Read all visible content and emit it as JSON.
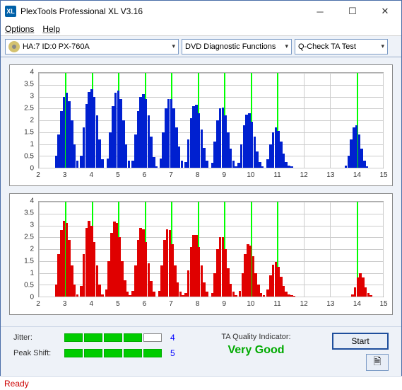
{
  "window": {
    "title": "PlexTools Professional XL V3.16"
  },
  "menu": {
    "options": "Options",
    "help": "Help"
  },
  "toolbar": {
    "device": "HA:7 ID:0   PX-760A",
    "diag": "DVD Diagnostic Functions",
    "test": "Q-Check TA Test"
  },
  "chart_data": [
    {
      "type": "bar",
      "color": "#0020d0",
      "xlim": [
        2,
        15
      ],
      "ylim": [
        0,
        4
      ],
      "yticks": [
        0,
        0.5,
        1,
        1.5,
        2,
        2.5,
        3,
        3.5,
        4
      ],
      "xticks": [
        2,
        3,
        4,
        5,
        6,
        7,
        8,
        9,
        10,
        11,
        12,
        13,
        14,
        15
      ],
      "markers": [
        3,
        4,
        5,
        6,
        7,
        8,
        9,
        10,
        11,
        14
      ],
      "series": [
        {
          "x": 2.65,
          "y": 0.5
        },
        {
          "x": 2.75,
          "y": 1.4
        },
        {
          "x": 2.85,
          "y": 2.4
        },
        {
          "x": 2.95,
          "y": 3.0
        },
        {
          "x": 3.05,
          "y": 3.15
        },
        {
          "x": 3.15,
          "y": 2.8
        },
        {
          "x": 3.25,
          "y": 2.0
        },
        {
          "x": 3.35,
          "y": 1.0
        },
        {
          "x": 3.45,
          "y": 0.3
        },
        {
          "x": 3.6,
          "y": 0.5
        },
        {
          "x": 3.7,
          "y": 1.7
        },
        {
          "x": 3.8,
          "y": 2.7
        },
        {
          "x": 3.9,
          "y": 3.2
        },
        {
          "x": 4.0,
          "y": 3.3
        },
        {
          "x": 4.1,
          "y": 3.0
        },
        {
          "x": 4.2,
          "y": 2.2
        },
        {
          "x": 4.3,
          "y": 1.2
        },
        {
          "x": 4.4,
          "y": 0.35
        },
        {
          "x": 4.6,
          "y": 0.4
        },
        {
          "x": 4.7,
          "y": 1.5
        },
        {
          "x": 4.8,
          "y": 2.6
        },
        {
          "x": 4.9,
          "y": 3.15
        },
        {
          "x": 5.0,
          "y": 3.25
        },
        {
          "x": 5.1,
          "y": 2.9
        },
        {
          "x": 5.2,
          "y": 2.0
        },
        {
          "x": 5.3,
          "y": 1.0
        },
        {
          "x": 5.4,
          "y": 0.3
        },
        {
          "x": 5.55,
          "y": 0.3
        },
        {
          "x": 5.65,
          "y": 1.4
        },
        {
          "x": 5.75,
          "y": 2.4
        },
        {
          "x": 5.85,
          "y": 3.0
        },
        {
          "x": 5.95,
          "y": 3.1
        },
        {
          "x": 6.05,
          "y": 2.9
        },
        {
          "x": 6.15,
          "y": 2.2
        },
        {
          "x": 6.25,
          "y": 1.3
        },
        {
          "x": 6.35,
          "y": 0.45
        },
        {
          "x": 6.45,
          "y": 0.05
        },
        {
          "x": 6.6,
          "y": 0.4
        },
        {
          "x": 6.7,
          "y": 1.5
        },
        {
          "x": 6.8,
          "y": 2.5
        },
        {
          "x": 6.9,
          "y": 2.9
        },
        {
          "x": 7.0,
          "y": 2.9
        },
        {
          "x": 7.1,
          "y": 2.5
        },
        {
          "x": 7.2,
          "y": 1.7
        },
        {
          "x": 7.3,
          "y": 0.9
        },
        {
          "x": 7.4,
          "y": 0.3
        },
        {
          "x": 7.55,
          "y": 0.25
        },
        {
          "x": 7.65,
          "y": 1.2
        },
        {
          "x": 7.75,
          "y": 2.1
        },
        {
          "x": 7.85,
          "y": 2.6
        },
        {
          "x": 7.95,
          "y": 2.65
        },
        {
          "x": 8.05,
          "y": 2.3
        },
        {
          "x": 8.15,
          "y": 1.6
        },
        {
          "x": 8.25,
          "y": 0.85
        },
        {
          "x": 8.35,
          "y": 0.3
        },
        {
          "x": 8.55,
          "y": 0.2
        },
        {
          "x": 8.65,
          "y": 1.1
        },
        {
          "x": 8.75,
          "y": 2.0
        },
        {
          "x": 8.85,
          "y": 2.5
        },
        {
          "x": 8.95,
          "y": 2.55
        },
        {
          "x": 9.05,
          "y": 2.2
        },
        {
          "x": 9.15,
          "y": 1.5
        },
        {
          "x": 9.25,
          "y": 0.8
        },
        {
          "x": 9.35,
          "y": 0.3
        },
        {
          "x": 9.45,
          "y": 0.05
        },
        {
          "x": 9.55,
          "y": 0.2
        },
        {
          "x": 9.65,
          "y": 1.0
        },
        {
          "x": 9.75,
          "y": 1.8
        },
        {
          "x": 9.85,
          "y": 2.25
        },
        {
          "x": 9.95,
          "y": 2.3
        },
        {
          "x": 10.05,
          "y": 1.95
        },
        {
          "x": 10.15,
          "y": 1.3
        },
        {
          "x": 10.25,
          "y": 0.7
        },
        {
          "x": 10.35,
          "y": 0.25
        },
        {
          "x": 10.45,
          "y": 0.05
        },
        {
          "x": 10.65,
          "y": 0.35
        },
        {
          "x": 10.75,
          "y": 1.0
        },
        {
          "x": 10.85,
          "y": 1.5
        },
        {
          "x": 10.95,
          "y": 1.7
        },
        {
          "x": 11.05,
          "y": 1.55
        },
        {
          "x": 11.15,
          "y": 1.1
        },
        {
          "x": 11.25,
          "y": 0.6
        },
        {
          "x": 11.35,
          "y": 0.25
        },
        {
          "x": 11.45,
          "y": 0.1
        },
        {
          "x": 11.55,
          "y": 0.05
        },
        {
          "x": 13.6,
          "y": 0.1
        },
        {
          "x": 13.7,
          "y": 0.5
        },
        {
          "x": 13.8,
          "y": 1.2
        },
        {
          "x": 13.9,
          "y": 1.7
        },
        {
          "x": 14.0,
          "y": 1.8
        },
        {
          "x": 14.1,
          "y": 1.4
        },
        {
          "x": 14.2,
          "y": 0.8
        },
        {
          "x": 14.3,
          "y": 0.3
        },
        {
          "x": 14.4,
          "y": 0.05
        }
      ]
    },
    {
      "type": "bar",
      "color": "#e00000",
      "xlim": [
        2,
        15
      ],
      "ylim": [
        0,
        4
      ],
      "yticks": [
        0,
        0.5,
        1,
        1.5,
        2,
        2.5,
        3,
        3.5,
        4
      ],
      "xticks": [
        2,
        3,
        4,
        5,
        6,
        7,
        8,
        9,
        10,
        11,
        12,
        13,
        14,
        15
      ],
      "markers": [
        3,
        4,
        5,
        6,
        7,
        8,
        9,
        10,
        11,
        14
      ],
      "series": [
        {
          "x": 2.65,
          "y": 0.5
        },
        {
          "x": 2.75,
          "y": 1.8
        },
        {
          "x": 2.85,
          "y": 2.8
        },
        {
          "x": 2.95,
          "y": 3.2
        },
        {
          "x": 3.05,
          "y": 3.1
        },
        {
          "x": 3.15,
          "y": 2.4
        },
        {
          "x": 3.25,
          "y": 1.3
        },
        {
          "x": 3.35,
          "y": 0.5
        },
        {
          "x": 3.45,
          "y": 0.1
        },
        {
          "x": 3.6,
          "y": 0.45
        },
        {
          "x": 3.7,
          "y": 1.8
        },
        {
          "x": 3.8,
          "y": 2.9
        },
        {
          "x": 3.9,
          "y": 3.2
        },
        {
          "x": 4.0,
          "y": 3.0
        },
        {
          "x": 4.1,
          "y": 2.3
        },
        {
          "x": 4.2,
          "y": 1.3
        },
        {
          "x": 4.3,
          "y": 0.5
        },
        {
          "x": 4.4,
          "y": 0.1
        },
        {
          "x": 4.55,
          "y": 0.3
        },
        {
          "x": 4.65,
          "y": 1.5
        },
        {
          "x": 4.75,
          "y": 2.7
        },
        {
          "x": 4.85,
          "y": 3.15
        },
        {
          "x": 4.95,
          "y": 3.1
        },
        {
          "x": 5.05,
          "y": 2.5
        },
        {
          "x": 5.15,
          "y": 1.5
        },
        {
          "x": 5.25,
          "y": 0.7
        },
        {
          "x": 5.35,
          "y": 0.2
        },
        {
          "x": 5.45,
          "y": 0.05
        },
        {
          "x": 5.55,
          "y": 0.25
        },
        {
          "x": 5.65,
          "y": 1.3
        },
        {
          "x": 5.75,
          "y": 2.4
        },
        {
          "x": 5.85,
          "y": 2.9
        },
        {
          "x": 5.95,
          "y": 2.85
        },
        {
          "x": 6.05,
          "y": 2.3
        },
        {
          "x": 6.15,
          "y": 1.4
        },
        {
          "x": 6.25,
          "y": 0.65
        },
        {
          "x": 6.35,
          "y": 0.2
        },
        {
          "x": 6.55,
          "y": 0.25
        },
        {
          "x": 6.65,
          "y": 1.3
        },
        {
          "x": 6.75,
          "y": 2.4
        },
        {
          "x": 6.85,
          "y": 2.85
        },
        {
          "x": 6.95,
          "y": 2.8
        },
        {
          "x": 7.05,
          "y": 2.2
        },
        {
          "x": 7.15,
          "y": 1.3
        },
        {
          "x": 7.25,
          "y": 0.6
        },
        {
          "x": 7.35,
          "y": 0.2
        },
        {
          "x": 7.45,
          "y": 0.05
        },
        {
          "x": 7.55,
          "y": 0.15
        },
        {
          "x": 7.65,
          "y": 1.1
        },
        {
          "x": 7.75,
          "y": 2.1
        },
        {
          "x": 7.85,
          "y": 2.6
        },
        {
          "x": 7.95,
          "y": 2.6
        },
        {
          "x": 8.05,
          "y": 2.1
        },
        {
          "x": 8.15,
          "y": 1.3
        },
        {
          "x": 8.25,
          "y": 0.6
        },
        {
          "x": 8.35,
          "y": 0.2
        },
        {
          "x": 8.55,
          "y": 0.15
        },
        {
          "x": 8.65,
          "y": 1.0
        },
        {
          "x": 8.75,
          "y": 2.0
        },
        {
          "x": 8.85,
          "y": 2.5
        },
        {
          "x": 8.95,
          "y": 2.5
        },
        {
          "x": 9.05,
          "y": 2.0
        },
        {
          "x": 9.15,
          "y": 1.2
        },
        {
          "x": 9.25,
          "y": 0.55
        },
        {
          "x": 9.35,
          "y": 0.2
        },
        {
          "x": 9.45,
          "y": 0.05
        },
        {
          "x": 9.6,
          "y": 0.25
        },
        {
          "x": 9.7,
          "y": 1.0
        },
        {
          "x": 9.8,
          "y": 1.8
        },
        {
          "x": 9.9,
          "y": 2.2
        },
        {
          "x": 10.0,
          "y": 2.15
        },
        {
          "x": 10.1,
          "y": 1.7
        },
        {
          "x": 10.2,
          "y": 1.0
        },
        {
          "x": 10.3,
          "y": 0.5
        },
        {
          "x": 10.4,
          "y": 0.15
        },
        {
          "x": 10.5,
          "y": 0.05
        },
        {
          "x": 10.65,
          "y": 0.3
        },
        {
          "x": 10.75,
          "y": 0.9
        },
        {
          "x": 10.85,
          "y": 1.35
        },
        {
          "x": 10.95,
          "y": 1.45
        },
        {
          "x": 11.05,
          "y": 1.25
        },
        {
          "x": 11.15,
          "y": 0.85
        },
        {
          "x": 11.25,
          "y": 0.45
        },
        {
          "x": 11.35,
          "y": 0.2
        },
        {
          "x": 11.45,
          "y": 0.1
        },
        {
          "x": 11.55,
          "y": 0.05
        },
        {
          "x": 11.65,
          "y": 0.025
        },
        {
          "x": 13.85,
          "y": 0.1
        },
        {
          "x": 13.95,
          "y": 0.4
        },
        {
          "x": 14.05,
          "y": 0.8
        },
        {
          "x": 14.15,
          "y": 1.0
        },
        {
          "x": 14.25,
          "y": 0.8
        },
        {
          "x": 14.35,
          "y": 0.4
        },
        {
          "x": 14.45,
          "y": 0.15
        },
        {
          "x": 14.55,
          "y": 0.05
        }
      ]
    }
  ],
  "meters": {
    "jitter": {
      "label": "Jitter:",
      "value": "4",
      "filled": 4,
      "total": 5
    },
    "peakshift": {
      "label": "Peak Shift:",
      "value": "5",
      "filled": 5,
      "total": 5
    }
  },
  "quality": {
    "label": "TA Quality Indicator:",
    "value": "Very Good"
  },
  "buttons": {
    "start": "Start"
  },
  "status": {
    "text": "Ready"
  }
}
